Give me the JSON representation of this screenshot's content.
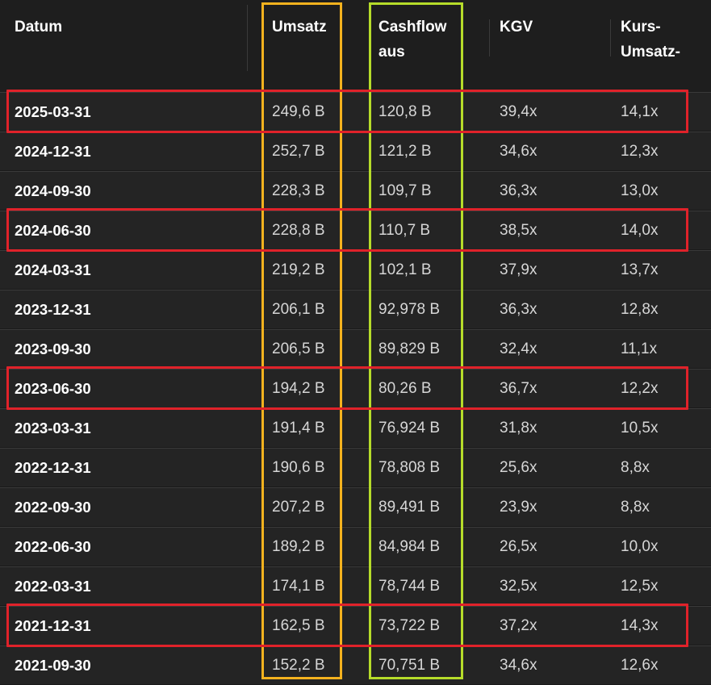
{
  "table": {
    "headers": [
      "Datum",
      "Umsatz",
      "Cashflow\naus",
      "KGV",
      "Kurs-\nUmsatz-"
    ],
    "rows": [
      {
        "date": "2025-03-31",
        "revenue": "249,6 B",
        "cashflow": "120,8 B",
        "pe": "39,4x",
        "ps": "14,1x"
      },
      {
        "date": "2024-12-31",
        "revenue": "252,7 B",
        "cashflow": "121,2 B",
        "pe": "34,6x",
        "ps": "12,3x"
      },
      {
        "date": "2024-09-30",
        "revenue": "228,3 B",
        "cashflow": "109,7 B",
        "pe": "36,3x",
        "ps": "13,0x"
      },
      {
        "date": "2024-06-30",
        "revenue": "228,8 B",
        "cashflow": "110,7 B",
        "pe": "38,5x",
        "ps": "14,0x"
      },
      {
        "date": "2024-03-31",
        "revenue": "219,2 B",
        "cashflow": "102,1 B",
        "pe": "37,9x",
        "ps": "13,7x"
      },
      {
        "date": "2023-12-31",
        "revenue": "206,1 B",
        "cashflow": "92,978 B",
        "pe": "36,3x",
        "ps": "12,8x"
      },
      {
        "date": "2023-09-30",
        "revenue": "206,5 B",
        "cashflow": "89,829 B",
        "pe": "32,4x",
        "ps": "11,1x"
      },
      {
        "date": "2023-06-30",
        "revenue": "194,2 B",
        "cashflow": "80,26 B",
        "pe": "36,7x",
        "ps": "12,2x"
      },
      {
        "date": "2023-03-31",
        "revenue": "191,4 B",
        "cashflow": "76,924 B",
        "pe": "31,8x",
        "ps": "10,5x"
      },
      {
        "date": "2022-12-31",
        "revenue": "190,6 B",
        "cashflow": "78,808 B",
        "pe": "25,6x",
        "ps": "8,8x"
      },
      {
        "date": "2022-09-30",
        "revenue": "207,2 B",
        "cashflow": "89,491 B",
        "pe": "23,9x",
        "ps": "8,8x"
      },
      {
        "date": "2022-06-30",
        "revenue": "189,2 B",
        "cashflow": "84,984 B",
        "pe": "26,5x",
        "ps": "10,0x"
      },
      {
        "date": "2022-03-31",
        "revenue": "174,1 B",
        "cashflow": "78,744 B",
        "pe": "32,5x",
        "ps": "12,5x"
      },
      {
        "date": "2021-12-31",
        "revenue": "162,5 B",
        "cashflow": "73,722 B",
        "pe": "37,2x",
        "ps": "14,3x"
      },
      {
        "date": "2021-09-30",
        "revenue": "152,2 B",
        "cashflow": "70,751 B",
        "pe": "34,6x",
        "ps": "12,6x"
      }
    ],
    "highlighted_rows": [
      0,
      3,
      7,
      13
    ]
  },
  "colors": {
    "row_highlight": "#e0222a",
    "revenue_column_highlight": "#f4b21e",
    "cashflow_column_highlight": "#b6dc2a"
  }
}
